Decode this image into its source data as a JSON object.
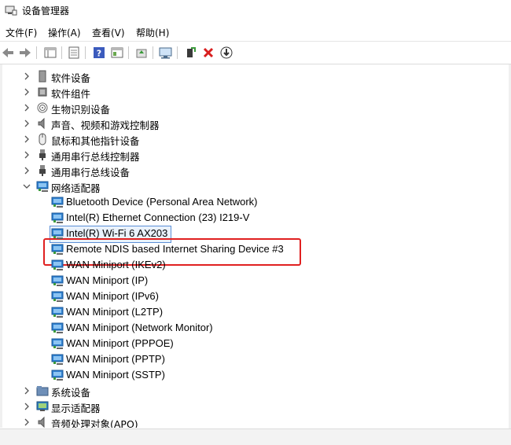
{
  "window": {
    "title": "设备管理器"
  },
  "menubar": {
    "items": [
      "文件(F)",
      "操作(A)",
      "查看(V)",
      "帮助(H)"
    ]
  },
  "toolbar": {
    "buttons": [
      "back-icon",
      "forward-icon",
      "show-hide-tree-icon",
      "properties-icon",
      "help-icon",
      "view-icon",
      "update-driver-icon",
      "scan-hardware-icon",
      "enable-device-icon",
      "uninstall-icon",
      "download-icon"
    ]
  },
  "tree": {
    "categories_top": [
      {
        "label": "软件设备",
        "icon": "software-device-icon"
      },
      {
        "label": "软件组件",
        "icon": "software-component-icon"
      },
      {
        "label": "生物识别设备",
        "icon": "fingerprint-icon"
      },
      {
        "label": "声音、视频和游戏控制器",
        "icon": "speaker-icon"
      },
      {
        "label": "鼠标和其他指针设备",
        "icon": "mouse-icon"
      },
      {
        "label": "通用串行总线控制器",
        "icon": "usb-icon"
      },
      {
        "label": "通用串行总线设备",
        "icon": "usb-icon"
      }
    ],
    "network": {
      "label": "网络适配器",
      "children": [
        "Bluetooth Device (Personal Area Network)",
        "Intel(R) Ethernet Connection (23) I219-V",
        "Intel(R) Wi-Fi 6 AX203",
        "Remote NDIS based Internet Sharing Device #3",
        "WAN Miniport (IKEv2)",
        "WAN Miniport (IP)",
        "WAN Miniport (IPv6)",
        "WAN Miniport (L2TP)",
        "WAN Miniport (Network Monitor)",
        "WAN Miniport (PPPOE)",
        "WAN Miniport (PPTP)",
        "WAN Miniport (SSTP)"
      ]
    },
    "categories_bottom": [
      {
        "label": "系统设备",
        "icon": "system-folder-icon"
      },
      {
        "label": "显示适配器",
        "icon": "display-adapter-icon"
      },
      {
        "label": "音频处理对象(APO)",
        "icon": "speaker-icon"
      }
    ]
  },
  "colors": {
    "highlight": "#e02020",
    "selection_border": "#5b8fd6",
    "selection_bg": "#eaf2fc",
    "network_icon": "#2f80d0"
  }
}
